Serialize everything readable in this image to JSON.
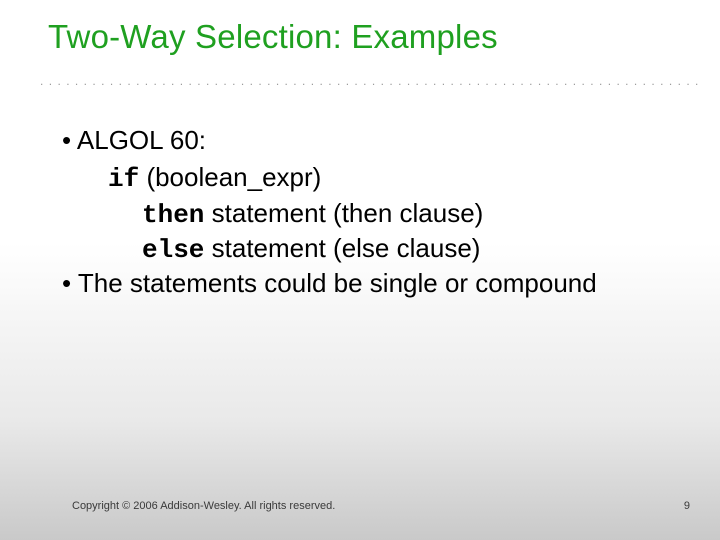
{
  "title": "Two-Way Selection: Examples",
  "bullets": {
    "b1": "ALGOL 60:",
    "line_if_kw": "if",
    "line_if_rest": " (boolean_expr)",
    "line_then_kw": "then",
    "line_then_rest": " statement  (then clause)",
    "line_else_kw": "else",
    "line_else_rest": " statement  (else clause)",
    "b2": "The statements could be single or compound"
  },
  "footer": {
    "copyright": "Copyright © 2006 Addison-Wesley. All rights reserved.",
    "page": "9"
  },
  "dots": "...................................................................................."
}
